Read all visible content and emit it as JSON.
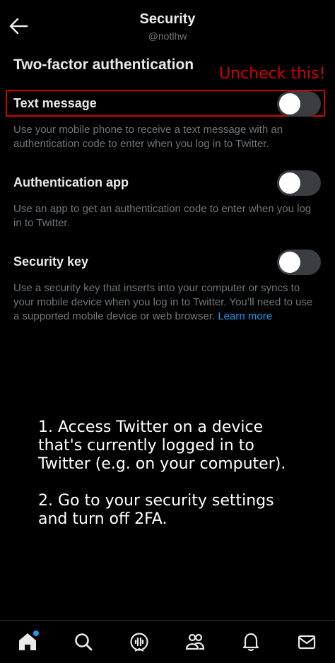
{
  "header": {
    "title": "Security",
    "handle": "@notlhw"
  },
  "section_title": "Two-factor authentication",
  "annotation": "Uncheck this!",
  "options": [
    {
      "label": "Text message",
      "description": "Use your mobile phone to receive a text message with an authentication code to enter when you log in to Twitter.",
      "enabled": false
    },
    {
      "label": "Authentication app",
      "description": "Use an app to get an authentication code to enter when you log in to Twitter.",
      "enabled": false
    },
    {
      "label": "Security key",
      "description": "Use a security key that inserts into your computer or syncs to your mobile device when you log in to Twitter. You’ll need to use a supported mobile device or web browser.",
      "link": "Learn more",
      "enabled": false
    }
  ],
  "notes": {
    "step1_line1": "1. Access Twitter on a device",
    "step1_line2": "that's currently logged in to",
    "step1_line3": "Twitter (e.g. on your computer).",
    "step2_line1": "2. Go to your security settings",
    "step2_line2": "and turn off 2FA."
  },
  "tabbar": {
    "items": [
      "home-icon",
      "search-icon",
      "spaces-icon",
      "communities-icon",
      "notifications-icon",
      "messages-icon"
    ],
    "accent": "#1d9bf0"
  },
  "colors": {
    "background": "#000000",
    "annotation": "#d40000",
    "link": "#1d9bf0"
  }
}
